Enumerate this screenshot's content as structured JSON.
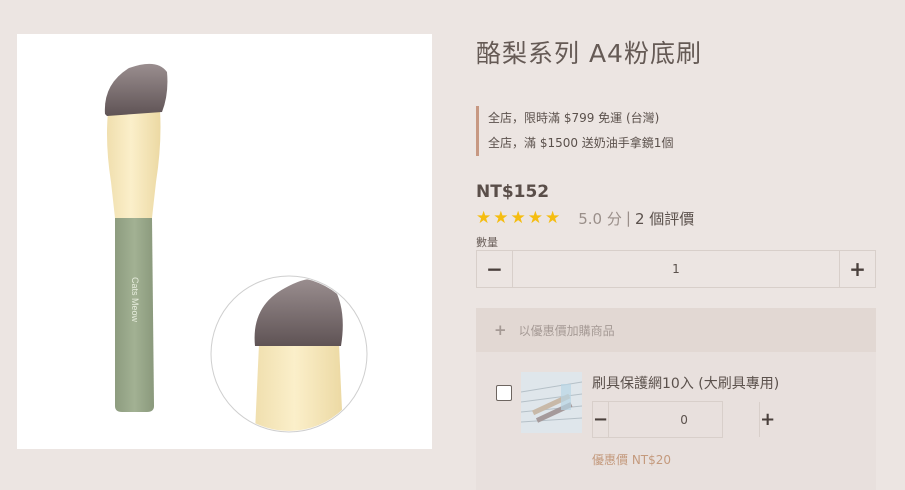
{
  "product": {
    "title": "酪梨系列 A4粉底刷",
    "image_brand_text": "Cats Meow",
    "promotions": [
      "全店，限時滿 $799 免運 (台灣)",
      "全店，滿 $1500 送奶油手拿鏡1個"
    ],
    "price": "NT$152",
    "rating": {
      "stars": 5,
      "score_text": "5.0 分",
      "separator": "|",
      "reviews_text": "2 個評價"
    },
    "quantity": {
      "label": "數量",
      "value": "1",
      "minus_symbol": "−",
      "plus_symbol": "+"
    }
  },
  "addon": {
    "header_icon": "+",
    "header_title": "以優惠價加購商品",
    "items": [
      {
        "name": "刷具保護網10入 (大刷具專用)",
        "quantity": "0",
        "minus_symbol": "−",
        "plus_symbol": "+",
        "price": "優惠價 NT$20"
      }
    ]
  },
  "colors": {
    "background": "#ece5e2",
    "accent_border": "#c79882",
    "star": "#f5bd10",
    "addon_price": "#c49a7d",
    "brush_handle": "#9aaa8b",
    "brush_ferrule": "#f5e6b8",
    "brush_bristles": "#76686a"
  }
}
